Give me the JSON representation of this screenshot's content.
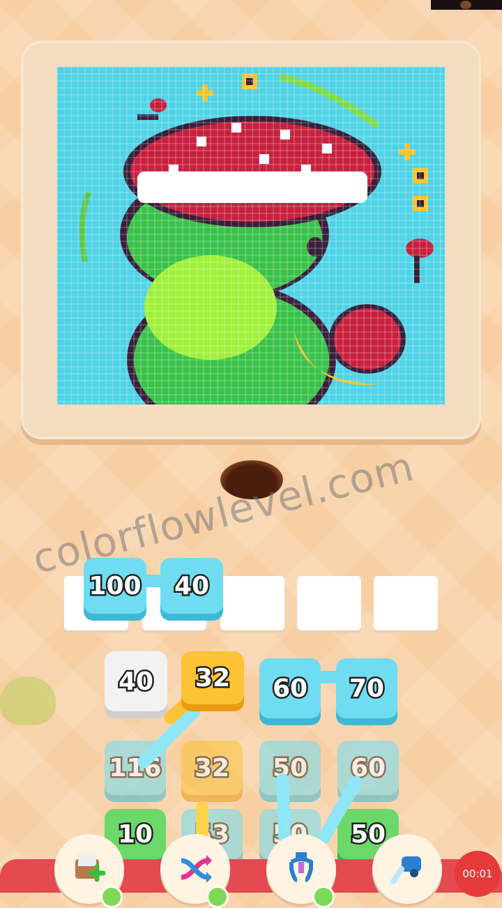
{
  "slots_row": {
    "tiles": [
      {
        "label": "100",
        "color": "#6fdcf2"
      },
      {
        "label": "40",
        "color": "#6fdcf2"
      }
    ],
    "empty_slots": 5
  },
  "board": {
    "row1": [
      {
        "label": "40",
        "style": "white"
      },
      {
        "label": "32",
        "style": "yellow"
      },
      {
        "label": "60",
        "style": "blue"
      },
      {
        "label": "70",
        "style": "blue"
      }
    ],
    "row2": [
      {
        "label": "116",
        "style": "blue"
      },
      {
        "label": "32",
        "style": "yellow"
      },
      {
        "label": "50",
        "style": "blue"
      },
      {
        "label": "60",
        "style": "blue"
      }
    ],
    "row3": [
      {
        "label": "10",
        "style": "green"
      },
      {
        "label": "53",
        "style": "blue"
      },
      {
        "label": "50",
        "style": "blue"
      },
      {
        "label": "50",
        "style": "green"
      }
    ]
  },
  "watermark": "colorflowlevel.com",
  "tools": [
    {
      "name": "add-slot",
      "icon": "add-box-icon"
    },
    {
      "name": "shuffle",
      "icon": "shuffle-arrows-icon"
    },
    {
      "name": "grab",
      "icon": "claw-icon"
    },
    {
      "name": "vacuum",
      "icon": "vacuum-icon"
    }
  ],
  "timer": "00:01",
  "colors": {
    "sky": "#4fd3e6",
    "frog": "#39c24a",
    "frog_belly": "#9ff03a",
    "mushroom": "#c8203e",
    "outline": "#3a1f3a",
    "accent": "#f5c42a"
  }
}
